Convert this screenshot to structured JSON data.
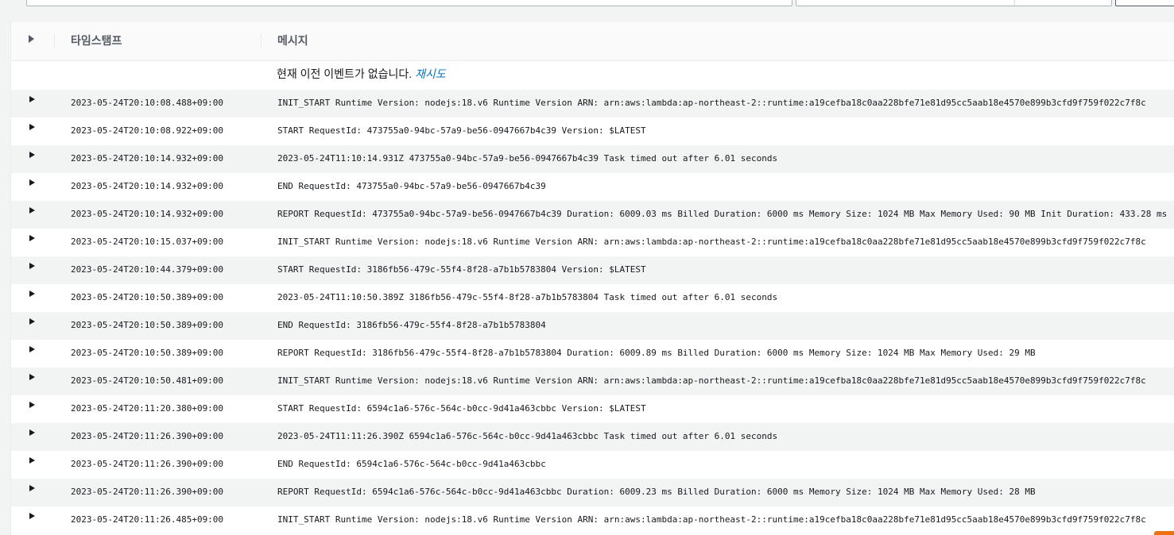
{
  "header": {
    "timestamp_label": "타임스탬프",
    "message_label": "메시지"
  },
  "no_recent": {
    "text": "현재 이전 이벤트가 없습니다.",
    "retry": "재시도"
  },
  "events": [
    {
      "timestamp": "2023-05-24T20:10:08.488+09:00",
      "message": "INIT_START Runtime Version: nodejs:18.v6 Runtime Version ARN: arn:aws:lambda:ap-northeast-2::runtime:a19cefba18c0aa228bfe71e81d95cc5aab18e4570e899b3cfd9f759f022c7f8c"
    },
    {
      "timestamp": "2023-05-24T20:10:08.922+09:00",
      "message": "START RequestId: 473755a0-94bc-57a9-be56-0947667b4c39 Version: $LATEST"
    },
    {
      "timestamp": "2023-05-24T20:10:14.932+09:00",
      "message": "2023-05-24T11:10:14.931Z 473755a0-94bc-57a9-be56-0947667b4c39 Task timed out after 6.01 seconds"
    },
    {
      "timestamp": "2023-05-24T20:10:14.932+09:00",
      "message": "END RequestId: 473755a0-94bc-57a9-be56-0947667b4c39"
    },
    {
      "timestamp": "2023-05-24T20:10:14.932+09:00",
      "message": "REPORT RequestId: 473755a0-94bc-57a9-be56-0947667b4c39 Duration: 6009.03 ms Billed Duration: 6000 ms Memory Size: 1024 MB Max Memory Used: 90 MB Init Duration: 433.28 ms"
    },
    {
      "timestamp": "2023-05-24T20:10:15.037+09:00",
      "message": "INIT_START Runtime Version: nodejs:18.v6 Runtime Version ARN: arn:aws:lambda:ap-northeast-2::runtime:a19cefba18c0aa228bfe71e81d95cc5aab18e4570e899b3cfd9f759f022c7f8c"
    },
    {
      "timestamp": "2023-05-24T20:10:44.379+09:00",
      "message": "START RequestId: 3186fb56-479c-55f4-8f28-a7b1b5783804 Version: $LATEST"
    },
    {
      "timestamp": "2023-05-24T20:10:50.389+09:00",
      "message": "2023-05-24T11:10:50.389Z 3186fb56-479c-55f4-8f28-a7b1b5783804 Task timed out after 6.01 seconds"
    },
    {
      "timestamp": "2023-05-24T20:10:50.389+09:00",
      "message": "END RequestId: 3186fb56-479c-55f4-8f28-a7b1b5783804"
    },
    {
      "timestamp": "2023-05-24T20:10:50.389+09:00",
      "message": "REPORT RequestId: 3186fb56-479c-55f4-8f28-a7b1b5783804 Duration: 6009.89 ms Billed Duration: 6000 ms Memory Size: 1024 MB Max Memory Used: 29 MB"
    },
    {
      "timestamp": "2023-05-24T20:10:50.481+09:00",
      "message": "INIT_START Runtime Version: nodejs:18.v6 Runtime Version ARN: arn:aws:lambda:ap-northeast-2::runtime:a19cefba18c0aa228bfe71e81d95cc5aab18e4570e899b3cfd9f759f022c7f8c"
    },
    {
      "timestamp": "2023-05-24T20:11:20.380+09:00",
      "message": "START RequestId: 6594c1a6-576c-564c-b0cc-9d41a463cbbc Version: $LATEST"
    },
    {
      "timestamp": "2023-05-24T20:11:26.390+09:00",
      "message": "2023-05-24T11:11:26.390Z 6594c1a6-576c-564c-b0cc-9d41a463cbbc Task timed out after 6.01 seconds"
    },
    {
      "timestamp": "2023-05-24T20:11:26.390+09:00",
      "message": "END RequestId: 6594c1a6-576c-564c-b0cc-9d41a463cbbc"
    },
    {
      "timestamp": "2023-05-24T20:11:26.390+09:00",
      "message": "REPORT RequestId: 6594c1a6-576c-564c-b0cc-9d41a463cbbc Duration: 6009.23 ms Billed Duration: 6000 ms Memory Size: 1024 MB Max Memory Used: 28 MB"
    },
    {
      "timestamp": "2023-05-24T20:11:26.485+09:00",
      "message": "INIT_START Runtime Version: nodejs:18.v6 Runtime Version ARN: arn:aws:lambda:ap-northeast-2::runtime:a19cefba18c0aa228bfe71e81d95cc5aab18e4570e899b3cfd9f759f022c7f8c"
    }
  ],
  "colors": {
    "link": "#0073bb",
    "row_stripe": "#f2f3f3",
    "text": "#16191f",
    "accent": "#ec7211"
  }
}
